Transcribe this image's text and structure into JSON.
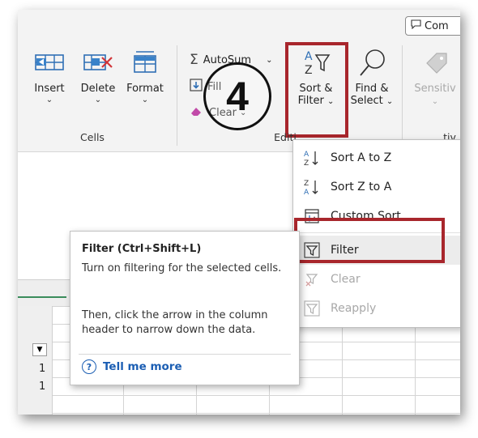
{
  "toolbar": {
    "comments_label": "Com"
  },
  "cells_group": {
    "insert_label": "Insert",
    "delete_label": "Delete",
    "format_label": "Format",
    "group_label": "Cells"
  },
  "editing_group": {
    "autosum_label": "AutoSum",
    "fill_label": "Fill",
    "clear_label": "Clear",
    "sort_filter_line1": "Sort &",
    "sort_filter_line2": "Filter",
    "find_select_line1": "Find &",
    "find_select_line2": "Select",
    "group_label": "Editi"
  },
  "sensitivity_group": {
    "label": "Sensitiv",
    "group_label_partial": "tiv"
  },
  "step_marker": "4",
  "sort_menu": {
    "items": [
      {
        "label": "Sort A to Z",
        "enabled": true
      },
      {
        "label": "Sort Z to A",
        "enabled": true
      },
      {
        "label": "Custom Sort...",
        "enabled": true
      },
      {
        "label": "Filter",
        "enabled": true
      },
      {
        "label": "Clear",
        "enabled": false
      },
      {
        "label": "Reapply",
        "enabled": false
      }
    ]
  },
  "tooltip": {
    "title": "Filter (Ctrl+Shift+L)",
    "line1": "Turn on filtering for the selected cells.",
    "line2": "Then, click the arrow in the column header to narrow down the data.",
    "tell_me_more": "Tell me more"
  },
  "grid": {
    "row_labels": [
      "1",
      "1"
    ]
  },
  "colors": {
    "highlight": "#a8262c",
    "link": "#1b5eb3",
    "accent_green": "#3a8c5b"
  }
}
